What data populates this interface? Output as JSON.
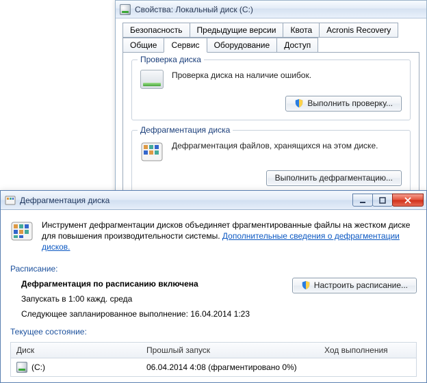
{
  "props": {
    "title": "Свойства: Локальный диск (C:)",
    "tabs_row1": [
      "Безопасность",
      "Предыдущие версии",
      "Квота",
      "Acronis Recovery"
    ],
    "tabs_row2": [
      "Общие",
      "Сервис",
      "Оборудование",
      "Доступ"
    ],
    "active_tab": "Сервис",
    "check": {
      "legend": "Проверка диска",
      "text": "Проверка диска на наличие ошибок.",
      "button": "Выполнить проверку..."
    },
    "defrag_group": {
      "legend": "Дефрагментация диска",
      "text": "Дефрагментация файлов, хранящихся на этом диске.",
      "button": "Выполнить дефрагментацию..."
    }
  },
  "defrag": {
    "title": "Дефрагментация диска",
    "intro_text": "Инструмент дефрагментации дисков объединяет фрагментированные файлы на жестком диске для повышения производительности системы. ",
    "intro_link": "Дополнительные сведения о дефрагментации дисков.",
    "schedule_label": "Расписание:",
    "schedule_status": "Дефрагментация по расписанию включена",
    "schedule_time": "Запускать в 1:00 кажд. среда",
    "schedule_next": "Следующее запланированное выполнение: 16.04.2014 1:23",
    "configure_btn": "Настроить расписание...",
    "state_label": "Текущее состояние:",
    "table": {
      "headers": {
        "disk": "Диск",
        "last": "Прошлый запуск",
        "progress": "Ход выполнения"
      },
      "row": {
        "disk": "(C:)",
        "last": "06.04.2014 4:08 (фрагментировано 0%)",
        "progress": ""
      }
    }
  }
}
